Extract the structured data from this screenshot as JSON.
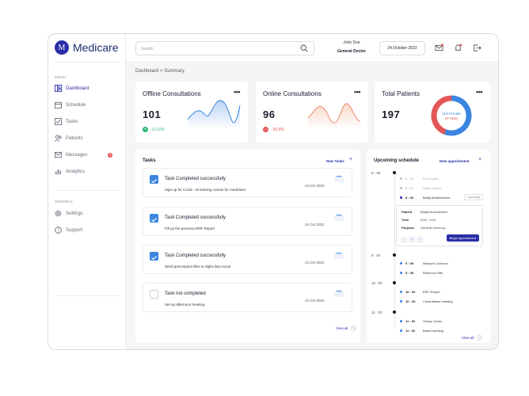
{
  "brand": {
    "logo_letter": "M",
    "name": "Medicare"
  },
  "sidebar": {
    "menu_title": "MENU",
    "items": [
      {
        "label": "Dashboard",
        "icon": "dashboard-icon",
        "active": true
      },
      {
        "label": "Schedule",
        "icon": "calendar-icon"
      },
      {
        "label": "Tasks",
        "icon": "tasks-icon"
      },
      {
        "label": "Patients",
        "icon": "patients-icon"
      },
      {
        "label": "Messages",
        "icon": "messages-icon",
        "badge": "3"
      },
      {
        "label": "Analytics",
        "icon": "analytics-icon"
      }
    ],
    "general_title": "GENERAL",
    "general_items": [
      {
        "label": "Settings",
        "icon": "gear-icon"
      },
      {
        "label": "Support",
        "icon": "help-icon"
      }
    ]
  },
  "header": {
    "search_placeholder": "Search",
    "user_name": "John Doe",
    "user_role": "General Doctor",
    "date": "24,October 2022"
  },
  "breadcrumb": "Dashboard > Summary",
  "cards": {
    "offline": {
      "title": "Offline Consultations",
      "value": "101",
      "delta": "+3.11%",
      "delta_color": "#2bb673"
    },
    "online": {
      "title": "Online Consultations",
      "value": "96",
      "delta": "-20.9%",
      "delta_color": "#e45757"
    },
    "patients": {
      "title": "Total Patients",
      "value": "197",
      "female_label": "110 Female",
      "male_label": "87 Male",
      "female_count": 110,
      "male_count": 87,
      "female_color": "#3a85e0",
      "male_color": "#e45757"
    },
    "more_glyph": "•••"
  },
  "tasks": {
    "title": "Tasks",
    "new_label": "New Tasks",
    "plus": "+",
    "view_all": "View all",
    "items": [
      {
        "title": "Task Completed successfully",
        "sub": "Sign up for Covid - 19 training course for medicians",
        "date": "24 Oct 2022",
        "done": true
      },
      {
        "title": "Task Completed successfully",
        "sub": "Fill up the previous ERP Report",
        "date": "24 Oct 2022",
        "done": true
      },
      {
        "title": "Task Completed successfully",
        "sub": "Send prescription files to Night duty nurse",
        "date": "24 Oct 2022",
        "done": true
      },
      {
        "title": "Task not completed",
        "sub": "Set up afternoon meeting",
        "date": "24 Oct 2022",
        "done": false
      }
    ],
    "menu_glyph": "•••"
  },
  "schedule": {
    "title": "Upcoming schedule",
    "new_label": "New appointment",
    "plus": "+",
    "view_all": "View all",
    "hours": [
      "8 : 00",
      "9 : 00",
      "10 : 00",
      "11 : 00"
    ],
    "events_8": [
      {
        "time": "8 : 00",
        "name": "Rina Kadlin",
        "muted": true
      },
      {
        "time": "8 : 00",
        "name": "Naiya Adams",
        "muted": true
      },
      {
        "time": "8 : 00",
        "name": "Balaji Abdulraheem",
        "muted": false,
        "tag": "Upcoming"
      }
    ],
    "detail": {
      "patient_k": "Patient",
      "patient_v": "Balaji Abdulraheem",
      "time_k": "Time",
      "time_v": "8:00 - 9:00",
      "purpose_k": "Purpose",
      "purpose_v": "General check-up",
      "button": "Begin appointment"
    },
    "events_9": [
      {
        "time": "9 : 00",
        "name": "Abeyomi Johnson"
      },
      {
        "time": "9 : 30",
        "name": "Rebecca Giffs"
      }
    ],
    "events_10": [
      {
        "time": "10 : 00",
        "name": "ERC Report"
      },
      {
        "time": "10 : 30",
        "name": "Consultation meeting"
      }
    ],
    "events_11": [
      {
        "time": "11 : 00",
        "name": "Victory Jones"
      },
      {
        "time": "11 : 30",
        "name": "Board meeting"
      }
    ]
  },
  "colors": {
    "accent": "#2a2ea8",
    "blue": "#3a85e0",
    "red": "#e45757",
    "green": "#2bb673"
  }
}
